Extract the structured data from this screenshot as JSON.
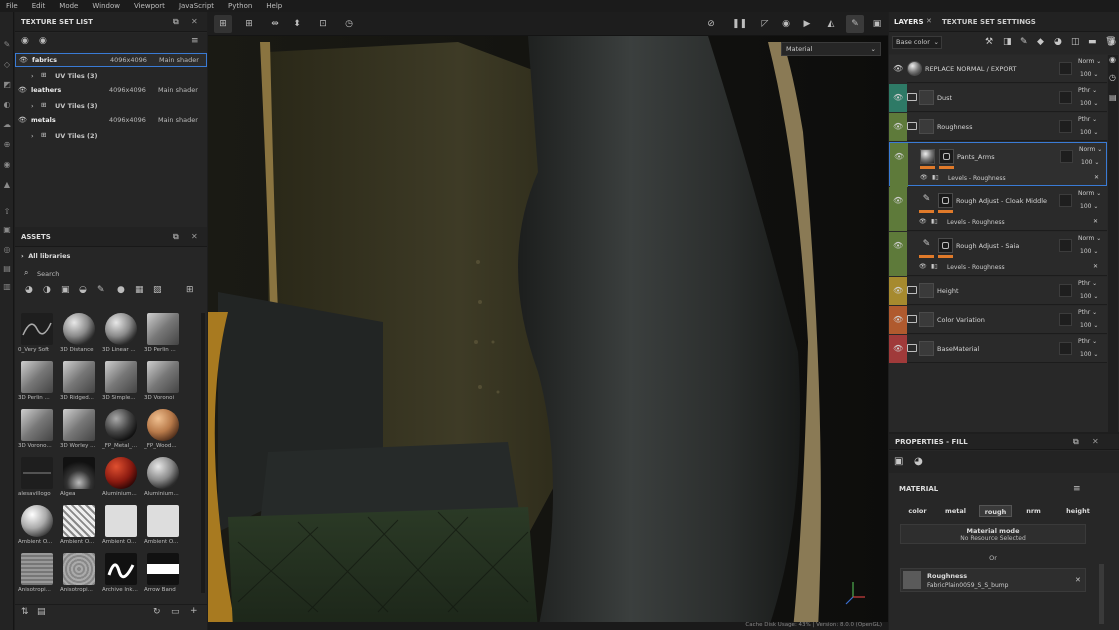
{
  "menubar": [
    "File",
    "Edit",
    "Mode",
    "Window",
    "Viewport",
    "JavaScript",
    "Python",
    "Help"
  ],
  "texture_set_list": {
    "title": "TEXTURE SET LIST",
    "sets": [
      {
        "name": "fabrics",
        "resolution": "4096x4096",
        "shader": "Main shader",
        "uv": "UV Tiles (3)"
      },
      {
        "name": "leathers",
        "resolution": "4096x4096",
        "shader": "Main shader",
        "uv": "UV Tiles (3)"
      },
      {
        "name": "metals",
        "resolution": "4096x4096",
        "shader": "Main shader",
        "uv": "UV Tiles (2)"
      }
    ]
  },
  "assets": {
    "title": "ASSETS",
    "library": "All libraries",
    "search_placeholder": "Search",
    "items": [
      {
        "label": "0_Very Soft",
        "look": "curve"
      },
      {
        "label": "3D Distance",
        "look": "sphere-grey"
      },
      {
        "label": "3D Linear ...",
        "look": "sphere-grey"
      },
      {
        "label": "3D Perlin ...",
        "look": "cube"
      },
      {
        "label": "3D Perlin ...",
        "look": "cube"
      },
      {
        "label": "3D Ridged...",
        "look": "cube"
      },
      {
        "label": "3D Simple...",
        "look": "cube"
      },
      {
        "label": "3D Voronoi",
        "look": "cube"
      },
      {
        "label": "3D Vorono...",
        "look": "cube"
      },
      {
        "label": "3D Worley ...",
        "look": "cube"
      },
      {
        "label": "_FP_Metal_...",
        "look": "sphere-dark"
      },
      {
        "label": "_FP_Wood...",
        "look": "sphere-wood"
      },
      {
        "label": "alesavillogo",
        "look": "line"
      },
      {
        "label": "Algea",
        "look": "burst"
      },
      {
        "label": "Aluminium...",
        "look": "sphere-red"
      },
      {
        "label": "Aluminium...",
        "look": "sphere-grey"
      },
      {
        "label": "Ambient O...",
        "look": "sphere-white"
      },
      {
        "label": "Ambient O...",
        "look": "noise"
      },
      {
        "label": "Ambient O...",
        "look": "num3"
      },
      {
        "label": "Ambient O...",
        "look": "num2"
      },
      {
        "label": "Anisotropi...",
        "look": "wood"
      },
      {
        "label": "Anisotropi...",
        "look": "wood2"
      },
      {
        "label": "Archive Ink...",
        "look": "ink"
      },
      {
        "label": "Arrow Band",
        "look": "band"
      }
    ]
  },
  "viewport": {
    "material_mode": "Material"
  },
  "layers": {
    "tab_layers": "LAYERS",
    "tab_tss": "TEXTURE SET SETTINGS",
    "channel": "Base color",
    "items": [
      {
        "name": "REPLACE NORMAL / EXPORT",
        "blend": "Norm",
        "opacity": "100",
        "color": "#2a2a2a",
        "kind": "fill"
      },
      {
        "name": "Dust",
        "blend": "Pthr",
        "opacity": "100",
        "color": "#2e7a66",
        "kind": "folder"
      },
      {
        "name": "Roughness",
        "blend": "Pthr",
        "opacity": "100",
        "color": "#5e7a3a",
        "kind": "folder"
      },
      {
        "name": "Pants_Arms",
        "blend": "Norm",
        "opacity": "100",
        "color": "#5e7a3a",
        "kind": "fill",
        "effect": "Levels - Roughness"
      },
      {
        "name": "Rough Adjust - Cloak Middle",
        "blend": "Norm",
        "opacity": "100",
        "color": "#5e7a3a",
        "kind": "paint",
        "effect": "Levels - Roughness"
      },
      {
        "name": "Rough Adjust - Saia",
        "blend": "Norm",
        "opacity": "100",
        "color": "#5e7a3a",
        "kind": "paint",
        "effect": "Levels - Roughness"
      },
      {
        "name": "Height",
        "blend": "Pthr",
        "opacity": "100",
        "color": "#a68a2e",
        "kind": "folder"
      },
      {
        "name": "Color Variation",
        "blend": "Pthr",
        "opacity": "100",
        "color": "#b05a2e",
        "kind": "folder"
      },
      {
        "name": "BaseMaterial",
        "blend": "Pthr",
        "opacity": "100",
        "color": "#a03a3a",
        "kind": "folder"
      }
    ]
  },
  "properties": {
    "title": "PROPERTIES - FILL",
    "section": "MATERIAL",
    "channels": [
      "color",
      "metal",
      "rough",
      "nrm",
      "height"
    ],
    "selected_channel": "rough",
    "material_mode_label": "Material mode",
    "material_mode_value": "No Resource Selected",
    "or_label": "Or",
    "slot_title": "Roughness",
    "slot_value": "FabricPlain0059_S_S_bump"
  },
  "statusbar": "Cache Disk Usage: 43% | Version: 8.0.0 (OpenGL)",
  "colors": {
    "accent": "#3a7bd5",
    "orange_bar": "#e07a2a"
  }
}
